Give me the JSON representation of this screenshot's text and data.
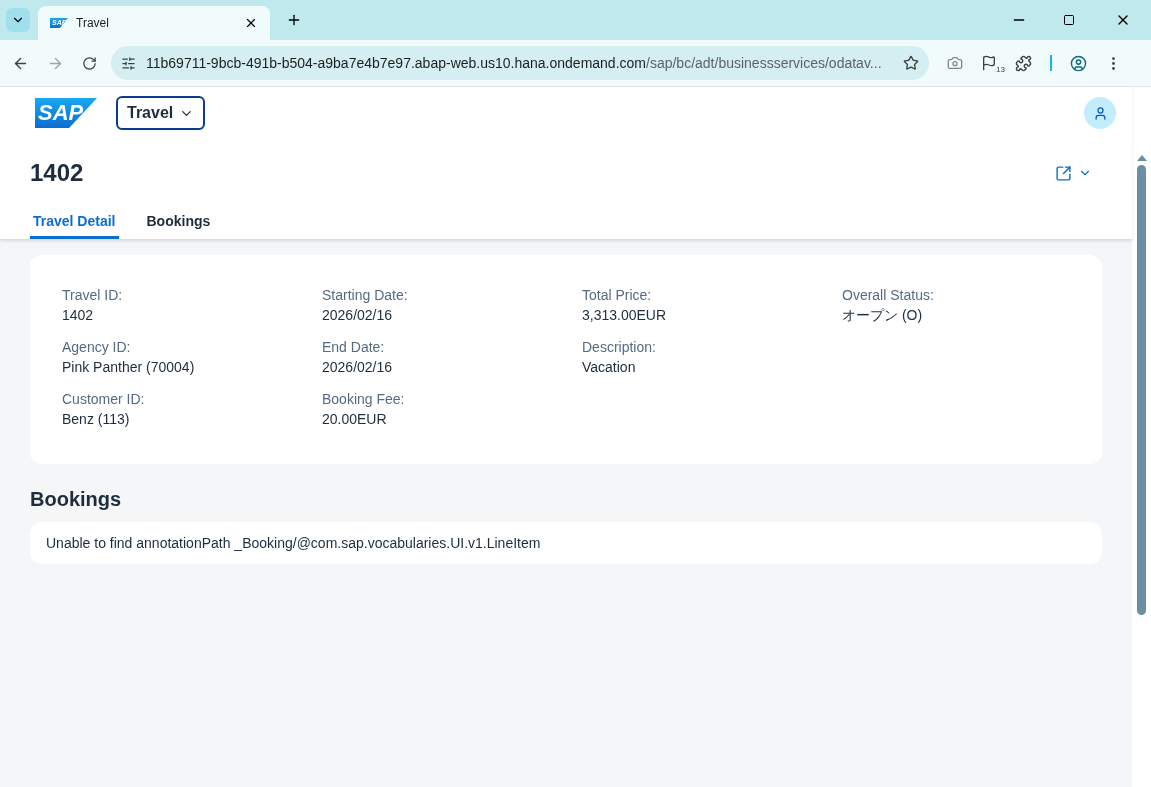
{
  "browser": {
    "tab_title": "Travel",
    "tab_logo": "SAP",
    "url_host": "11b69711-9bcb-491b-b504-a9ba7e4b7e97.abap-web.us10.hana.ondemand.com",
    "url_path": "/sap/bc/adt/businessservices/odatav...",
    "flag_count": "13"
  },
  "shell": {
    "logo": "SAP",
    "app_menu": "Travel"
  },
  "header": {
    "title": "1402"
  },
  "tabs": [
    {
      "label": "Travel Detail",
      "selected": true
    },
    {
      "label": "Bookings",
      "selected": false
    }
  ],
  "detail_columns": [
    [
      {
        "label": "Travel ID:",
        "value": "1402"
      },
      {
        "label": "Agency ID:",
        "value": "Pink Panther (70004)"
      },
      {
        "label": "Customer ID:",
        "value": "Benz (113)"
      }
    ],
    [
      {
        "label": "Starting Date:",
        "value": "2026/02/16"
      },
      {
        "label": "End Date:",
        "value": "2026/02/16"
      },
      {
        "label": "Booking Fee:",
        "value": "20.00EUR"
      }
    ],
    [
      {
        "label": "Total Price:",
        "value": "3,313.00EUR"
      },
      {
        "label": "Description:",
        "value": "Vacation"
      }
    ],
    [
      {
        "label": "Overall Status:",
        "value": "オープン (O)"
      }
    ]
  ],
  "bookings": {
    "title": "Bookings",
    "message": "Unable to find annotationPath _Booking/@com.sap.vocabularies.UI.v1.LineItem"
  }
}
